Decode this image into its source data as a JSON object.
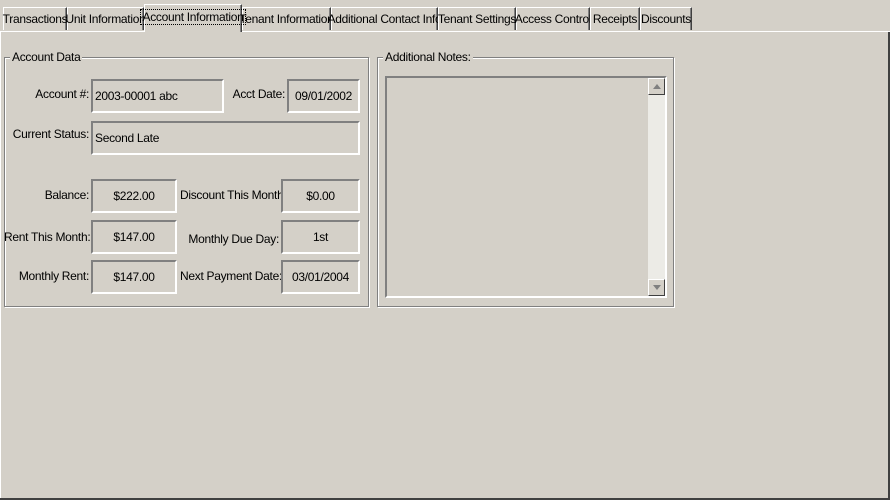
{
  "tabs": [
    {
      "label": "Transactions"
    },
    {
      "label": "Unit Information"
    },
    {
      "label": "Account Information"
    },
    {
      "label": "Tenant Information"
    },
    {
      "label": "Additional Contact Info"
    },
    {
      "label": "Tenant Settings"
    },
    {
      "label": "Access Control"
    },
    {
      "label": "Receipts"
    },
    {
      "label": "Discounts"
    }
  ],
  "active_tab": "Account Information",
  "account_data": {
    "title": "Account Data",
    "account_no": {
      "label": "Account #:",
      "value": "2003-00001 abc"
    },
    "acct_date": {
      "label": "Acct Date:",
      "value": "09/01/2002"
    },
    "current_status": {
      "label": "Current Status:",
      "value": "Second Late"
    },
    "balance": {
      "label": "Balance:",
      "value": "$222.00"
    },
    "discount_this_month": {
      "label": "Discount This Month:",
      "value": "$0.00"
    },
    "rent_this_month": {
      "label": "Rent This Month:",
      "value": "$147.00"
    },
    "monthly_due_day": {
      "label": "Monthly Due Day:",
      "value": "1st"
    },
    "monthly_rent": {
      "label": "Monthly Rent:",
      "value": "$147.00"
    },
    "next_payment_date": {
      "label": "Next Payment Date:",
      "value": "03/01/2004"
    }
  },
  "notes": {
    "title": "Additional Notes:",
    "value": ""
  }
}
